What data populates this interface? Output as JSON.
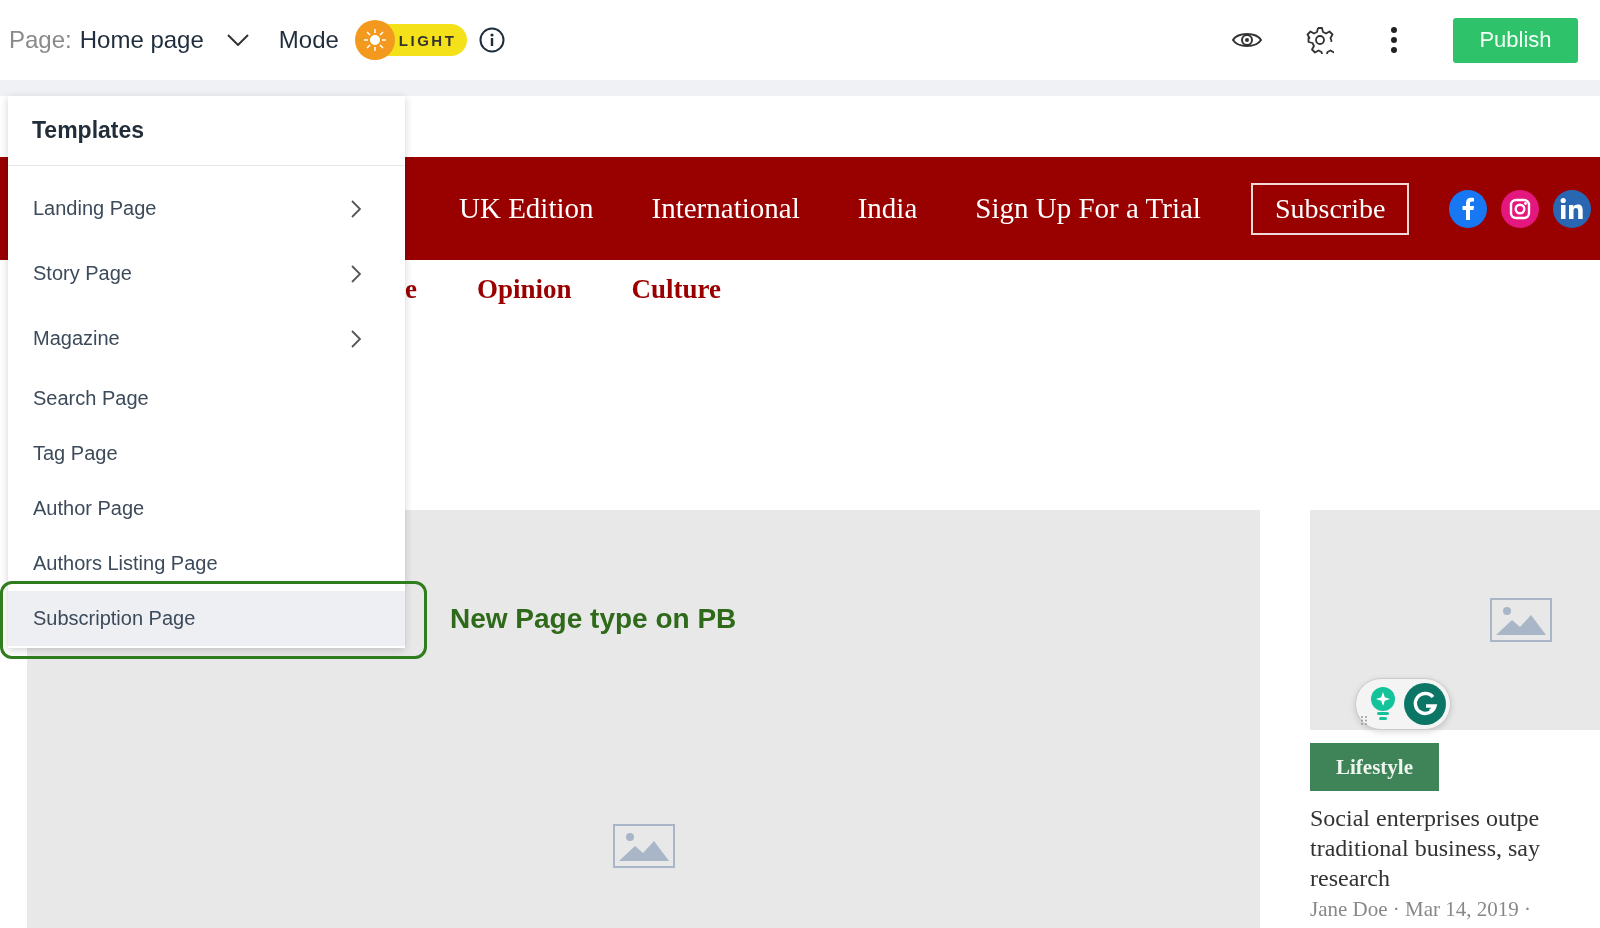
{
  "topbar": {
    "page_label": "Page:",
    "page_name": "Home page",
    "mode_label": "Mode",
    "mode_toggle": {
      "label": "LIGHT",
      "dark": false
    },
    "publish": "Publish"
  },
  "templates_menu": {
    "title": "Templates",
    "items": [
      {
        "label": "Landing Page",
        "has_submenu": true,
        "selected": false
      },
      {
        "label": "Story Page",
        "has_submenu": true,
        "selected": false
      },
      {
        "label": "Magazine",
        "has_submenu": true,
        "selected": false
      },
      {
        "label": "Search Page",
        "has_submenu": false,
        "selected": false
      },
      {
        "label": "Tag Page",
        "has_submenu": false,
        "selected": false
      },
      {
        "label": "Author Page",
        "has_submenu": false,
        "selected": false
      },
      {
        "label": "Authors Listing Page",
        "has_submenu": false,
        "selected": false
      },
      {
        "label": "Subscription Page",
        "has_submenu": false,
        "selected": true
      }
    ]
  },
  "annotation": "New Page type on PB",
  "site_nav": {
    "items": [
      "UK Edition",
      "International",
      "India",
      "Sign Up For a Trial"
    ],
    "subscribe": "Subscribe"
  },
  "section_nav": [
    "e",
    "Opinion",
    "Culture"
  ],
  "story_card": {
    "tag": "Lifestyle",
    "headline_lines": [
      "Social enterprises outpe",
      "traditional business, say",
      "research"
    ],
    "meta": "Jane Doe · Mar 14, 2019 ·"
  }
}
